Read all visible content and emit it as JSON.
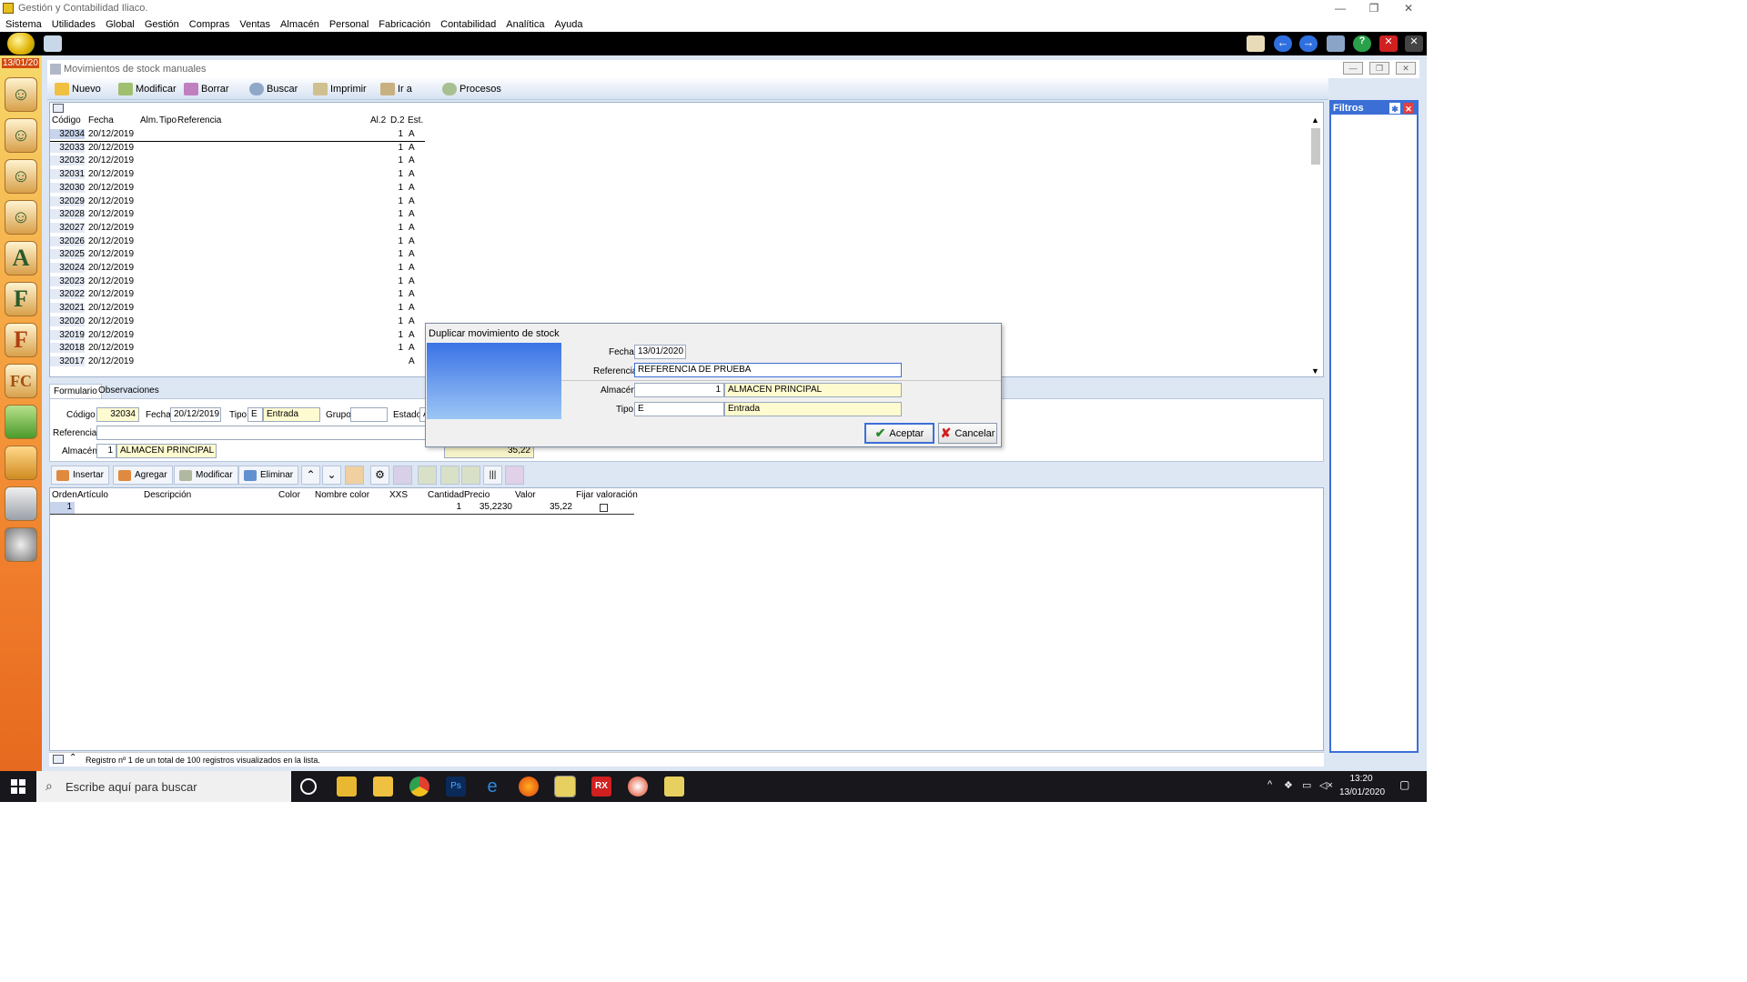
{
  "window": {
    "title": "Gestión y Contabilidad Iliaco."
  },
  "menu": [
    "Sistema",
    "Utilidades",
    "Global",
    "Gestión",
    "Compras",
    "Ventas",
    "Almacén",
    "Personal",
    "Fabricación",
    "Contabilidad",
    "Analítica",
    "Ayuda"
  ],
  "leftbar": {
    "date": "13/01/20",
    "icons": [
      "",
      "",
      "",
      "",
      "A",
      "F",
      "F",
      "FC",
      "",
      "",
      "",
      ""
    ]
  },
  "child": {
    "title": "Movimientos de stock manuales"
  },
  "toolbar": {
    "nuevo": "Nuevo",
    "modificar": "Modificar",
    "borrar": "Borrar",
    "buscar": "Buscar",
    "imprimir": "Imprimir",
    "ira": "Ir a",
    "procesos": "Procesos"
  },
  "grid": {
    "headers": {
      "codigo": "Código",
      "fecha": "Fecha",
      "alm": "Alm.",
      "tipo": "Tipo",
      "referencia": "Referencia",
      "al2": "Al.2",
      "d2": "D.2",
      "est": "Est."
    },
    "rows": [
      {
        "codigo": "32034",
        "fecha": "20/12/2019",
        "d2": "1",
        "est": "A"
      },
      {
        "codigo": "32033",
        "fecha": "20/12/2019",
        "d2": "1",
        "est": "A"
      },
      {
        "codigo": "32032",
        "fecha": "20/12/2019",
        "d2": "1",
        "est": "A"
      },
      {
        "codigo": "32031",
        "fecha": "20/12/2019",
        "d2": "1",
        "est": "A"
      },
      {
        "codigo": "32030",
        "fecha": "20/12/2019",
        "d2": "1",
        "est": "A"
      },
      {
        "codigo": "32029",
        "fecha": "20/12/2019",
        "d2": "1",
        "est": "A"
      },
      {
        "codigo": "32028",
        "fecha": "20/12/2019",
        "d2": "1",
        "est": "A"
      },
      {
        "codigo": "32027",
        "fecha": "20/12/2019",
        "d2": "1",
        "est": "A"
      },
      {
        "codigo": "32026",
        "fecha": "20/12/2019",
        "d2": "1",
        "est": "A"
      },
      {
        "codigo": "32025",
        "fecha": "20/12/2019",
        "d2": "1",
        "est": "A"
      },
      {
        "codigo": "32024",
        "fecha": "20/12/2019",
        "d2": "1",
        "est": "A"
      },
      {
        "codigo": "32023",
        "fecha": "20/12/2019",
        "d2": "1",
        "est": "A"
      },
      {
        "codigo": "32022",
        "fecha": "20/12/2019",
        "d2": "1",
        "est": "A"
      },
      {
        "codigo": "32021",
        "fecha": "20/12/2019",
        "d2": "1",
        "est": "A"
      },
      {
        "codigo": "32020",
        "fecha": "20/12/2019",
        "d2": "1",
        "est": "A"
      },
      {
        "codigo": "32019",
        "fecha": "20/12/2019",
        "d2": "1",
        "est": "A"
      },
      {
        "codigo": "32018",
        "fecha": "20/12/2019",
        "d2": "1",
        "est": "A"
      },
      {
        "codigo": "32017",
        "fecha": "20/12/2019",
        "d2": "",
        "est": "A"
      }
    ]
  },
  "filtros": {
    "title": "Filtros"
  },
  "tabs": {
    "formulario": "Formulario",
    "observaciones": "Observaciones"
  },
  "form": {
    "codigo_label": "Código",
    "codigo": "32034",
    "fecha_label": "Fecha",
    "fecha": "20/12/2019",
    "tipo_label": "Tipo",
    "tipo_code": "E",
    "tipo_name": "Entrada",
    "grupo_label": "Grupo",
    "grupo": "",
    "estado_label": "Estado",
    "estado": "A",
    "referencia_label": "Referencia",
    "referencia": "",
    "almacen_label": "Almacén",
    "almacen_code": "1",
    "almacen_name": "ALMACEN PRINCIPAL",
    "total": "35,22"
  },
  "linetoolbar": {
    "insertar": "Insertar",
    "agregar": "Agregar",
    "modificar": "Modificar",
    "eliminar": "Eliminar"
  },
  "lines": {
    "headers": {
      "orden": "Orden",
      "articulo": "Artículo",
      "descripcion": "Descripción",
      "color": "Color",
      "nombre_color": "Nombre color",
      "xxs": "XXS",
      "cantidad": "Cantidad",
      "precio": "Precio",
      "valor": "Valor",
      "fijar": "Fijar valoración"
    },
    "row": {
      "orden": "1",
      "cantidad": "1",
      "precio": "35,2230",
      "valor": "35,22"
    }
  },
  "status": {
    "text": "Registro nº 1 de un total de 100 registros visualizados en la lista."
  },
  "dialog": {
    "title": "Duplicar movimiento de stock",
    "fecha_label": "Fecha",
    "fecha": "13/01/2020",
    "referencia_label": "Referencia",
    "referencia": "REFERENCIA DE PRUEBA",
    "almacen_label": "Almacén",
    "almacen_code": "1",
    "almacen_name": "ALMACEN PRINCIPAL",
    "tipo_label": "Tipo",
    "tipo_code": "E",
    "tipo_name": "Entrada",
    "aceptar": "Aceptar",
    "cancelar": "Cancelar"
  },
  "taskbar": {
    "search_placeholder": "Escribe aquí para buscar",
    "time": "13:20",
    "date": "13/01/2020",
    "apps": [
      "cortana",
      "explorer",
      "files",
      "chrome",
      "photoshop",
      "edge",
      "firefox",
      "app1",
      "rx",
      "app2",
      "app3"
    ]
  },
  "colors": {
    "accent": "#3b6fd6",
    "yellow_field": "#fffbd0",
    "mdi_bg": "#dde6f3"
  }
}
